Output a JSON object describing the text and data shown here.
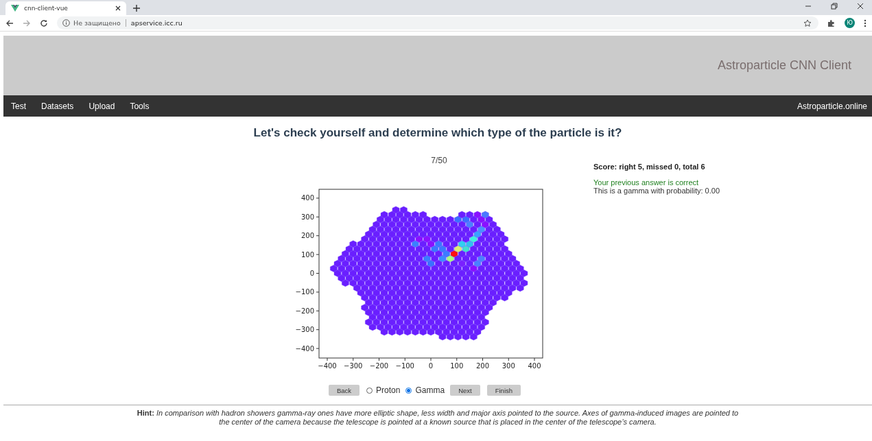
{
  "browser": {
    "tab_title": "cnn-client-vue",
    "security": "Не защищено",
    "url": "apservice.icc.ru",
    "avatar": "Ю"
  },
  "header": {
    "title": "Astroparticle CNN Client"
  },
  "nav": {
    "items": [
      {
        "label": "Test"
      },
      {
        "label": "Datasets"
      },
      {
        "label": "Upload"
      },
      {
        "label": "Tools"
      }
    ],
    "brand": "Astroparticle.online"
  },
  "heading": "Let's check yourself and determine which type of the particle is it?",
  "quiz": {
    "progress": "7/50",
    "plot": {
      "x_ticks": [
        "−400",
        "−300",
        "−200",
        "−100",
        "0",
        "100",
        "200",
        "300",
        "400"
      ],
      "y_ticks": [
        "400",
        "300",
        "200",
        "100",
        "0",
        "−100",
        "−200",
        "−300",
        "−400"
      ]
    },
    "back": "Back",
    "options": [
      {
        "label": "Proton",
        "selected": false
      },
      {
        "label": "Gamma",
        "selected": true
      }
    ],
    "next": "Next",
    "finish": "Finish"
  },
  "score": {
    "summary": "Score: right 5, missed 0, total 6",
    "feedback": "Your previous answer is correct",
    "probability": "This is a gamma with probability: 0.00"
  },
  "hint": "**Hint:** *In comparison with hadron showers gamma-ray ones have more elliptic shape, less width and major axis pointed to the source. Axes of gamma-induced images are pointed to the center of the camera because the telescope is pointed at a known source that is placed in the center of the telescope’s camera.*"
}
